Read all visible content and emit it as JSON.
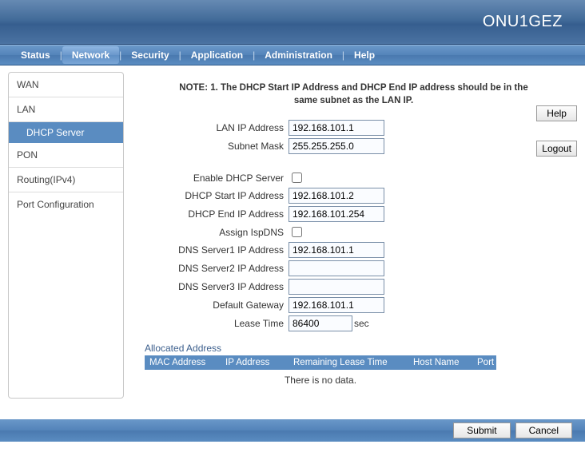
{
  "header": {
    "title": "ONU1GEZ"
  },
  "topnav": {
    "items": [
      "Status",
      "Network",
      "Security",
      "Application",
      "Administration",
      "Help"
    ],
    "active_index": 1
  },
  "sidebar": {
    "items": [
      {
        "label": "WAN",
        "children": []
      },
      {
        "label": "LAN",
        "children": [
          {
            "label": "DHCP Server",
            "active": true
          }
        ]
      },
      {
        "label": "PON",
        "children": []
      },
      {
        "label": "Routing(IPv4)",
        "children": []
      },
      {
        "label": "Port Configuration",
        "children": []
      }
    ]
  },
  "side_buttons": {
    "help": "Help",
    "logout": "Logout"
  },
  "note": "NOTE: 1. The DHCP Start IP Address and DHCP End IP address should be in the same subnet as the LAN IP.",
  "fields": {
    "lan_ip": {
      "label": "LAN IP Address",
      "value": "192.168.101.1"
    },
    "subnet": {
      "label": "Subnet Mask",
      "value": "255.255.255.0"
    },
    "enable_dhcp": {
      "label": "Enable DHCP Server",
      "checked": false
    },
    "dhcp_start": {
      "label": "DHCP Start IP Address",
      "value": "192.168.101.2"
    },
    "dhcp_end": {
      "label": "DHCP End IP Address",
      "value": "192.168.101.254"
    },
    "assign_ispdns": {
      "label": "Assign IspDNS",
      "checked": false
    },
    "dns1": {
      "label": "DNS Server1 IP Address",
      "value": "192.168.101.1"
    },
    "dns2": {
      "label": "DNS Server2 IP Address",
      "value": ""
    },
    "dns3": {
      "label": "DNS Server3 IP Address",
      "value": ""
    },
    "gateway": {
      "label": "Default Gateway",
      "value": "192.168.101.1"
    },
    "lease": {
      "label": "Lease Time",
      "value": "86400",
      "unit": "sec"
    }
  },
  "allocated": {
    "title": "Allocated Address",
    "columns": [
      "MAC Address",
      "IP Address",
      "Remaining Lease Time",
      "Host Name",
      "Port"
    ],
    "rows": [],
    "empty": "There is no data."
  },
  "footer": {
    "submit": "Submit",
    "cancel": "Cancel"
  }
}
